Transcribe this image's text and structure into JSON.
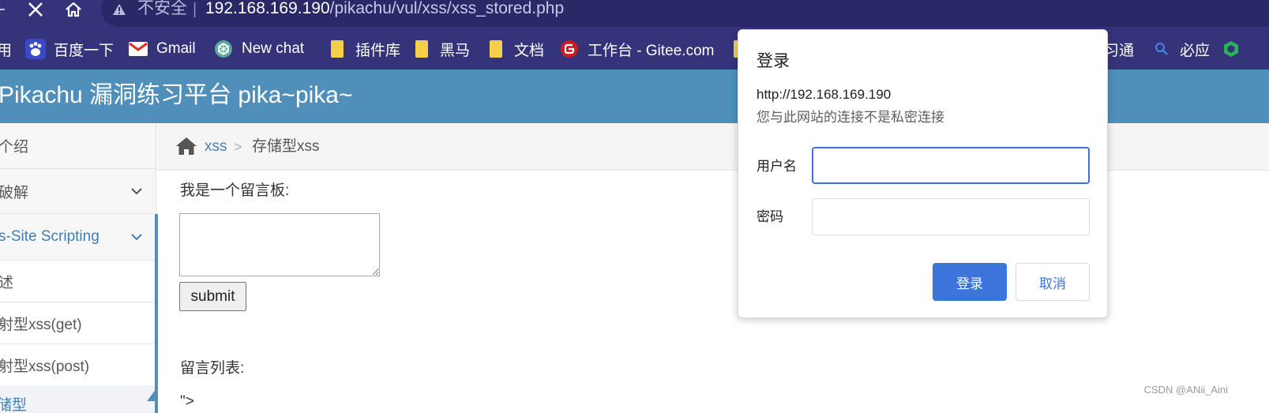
{
  "browser": {
    "security_label": "不安全",
    "separator": "|",
    "url_host": "192.168.169.190",
    "url_path": "/pikachu/vul/xss/xss_stored.php"
  },
  "bookmarks": [
    {
      "label": "用",
      "icon": "apps-icon"
    },
    {
      "label": "百度一下",
      "icon": "baidu-icon"
    },
    {
      "label": "Gmail",
      "icon": "gmail-icon"
    },
    {
      "label": "New chat",
      "icon": "chatgpt-icon"
    },
    {
      "label": "插件库",
      "icon": "folder-icon"
    },
    {
      "label": "黑马",
      "icon": "folder-icon"
    },
    {
      "label": "文档",
      "icon": "folder-icon"
    },
    {
      "label": "工作台 - Gitee.com",
      "icon": "gitee-icon"
    },
    {
      "label": "习通",
      "icon": "xuexitong-icon"
    },
    {
      "label": "必应",
      "icon": "bing-search-icon"
    }
  ],
  "header": {
    "title": "Pikachu 漏洞练习平台 pika~pika~"
  },
  "sidebar": {
    "items": [
      {
        "label": "个绍"
      },
      {
        "label": "破解"
      },
      {
        "label": "s-Site Scripting"
      },
      {
        "label": "述"
      },
      {
        "label": "射型xss(get)"
      },
      {
        "label": "射型xss(post)"
      },
      {
        "label": "储型"
      }
    ]
  },
  "breadcrumb": {
    "link": "xss",
    "separator": ">",
    "current": "存储型xss"
  },
  "main": {
    "message_label": "我是一个留言板:",
    "message_value": "",
    "submit_label": "submit",
    "list_label": "留言列表:",
    "list_fragment": "\">"
  },
  "dialog": {
    "title": "登录",
    "url": "http://192.168.169.190",
    "note": "您与此网站的连接不是私密连接",
    "username_label": "用户名",
    "username_value": "",
    "password_label": "密码",
    "password_value": "",
    "login_label": "登录",
    "cancel_label": "取消"
  },
  "watermark": "CSDN @ANii_Aini",
  "colors": {
    "browser_bar": "#35337a",
    "header": "#4f8fba",
    "link": "#4e83b3",
    "primary_button": "#3c74dc"
  }
}
